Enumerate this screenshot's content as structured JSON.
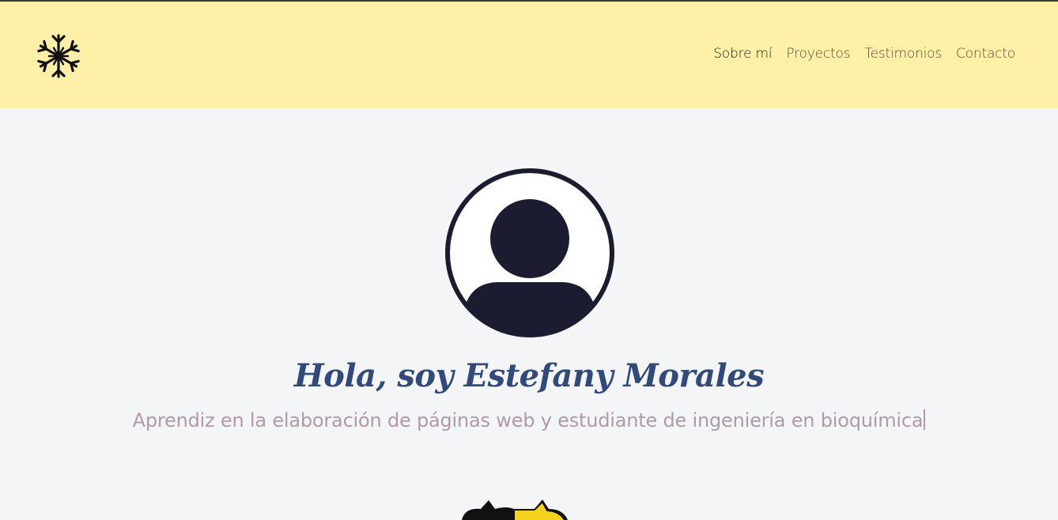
{
  "header": {
    "logo_icon": "snowflake-icon",
    "nav": [
      {
        "label": "Sobre mí",
        "active": true
      },
      {
        "label": "Proyectos",
        "active": false
      },
      {
        "label": "Testimonios",
        "active": false
      },
      {
        "label": "Contacto",
        "active": false
      }
    ]
  },
  "hero": {
    "avatar_icon": "user-avatar-icon",
    "title": "Hola, soy Estefany Morales",
    "subtitle": "Aprendiz en la elaboración de páginas web y estudiante de ingeniería en bioquímica"
  },
  "colors": {
    "header_bg": "#fff0a8",
    "page_bg": "#f4f5f7",
    "title": "#324a7a",
    "subtitle": "#b09aa9",
    "avatar_dark": "#1c1c30"
  }
}
